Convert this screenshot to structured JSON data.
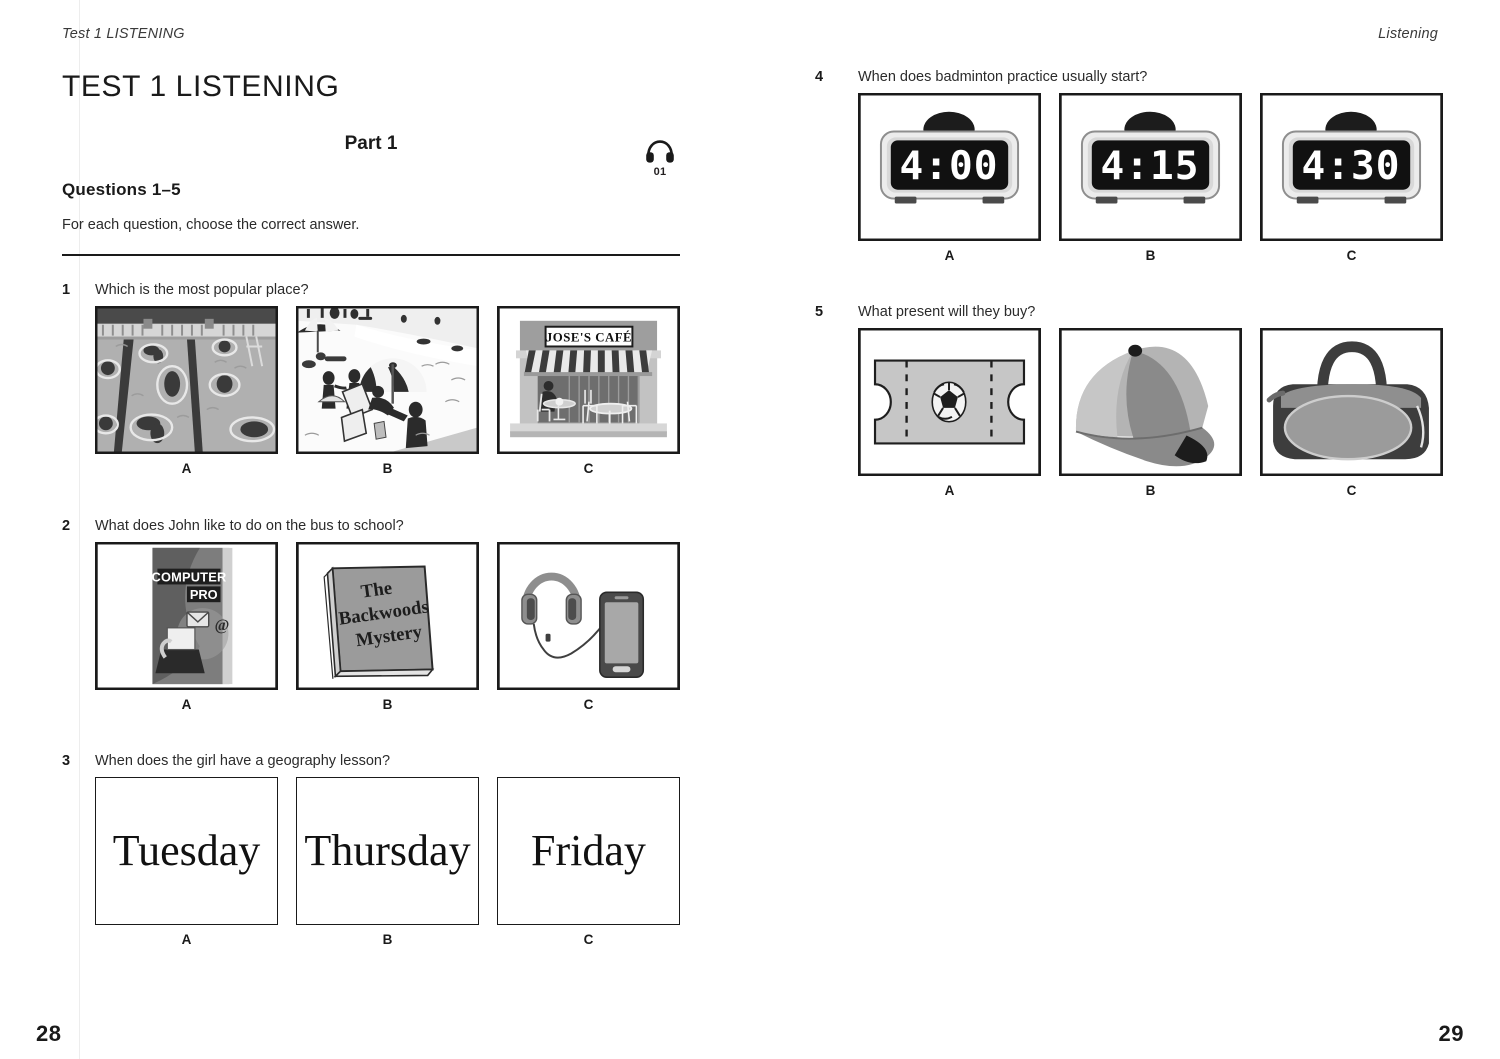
{
  "left_page": {
    "running_head": "Test 1 LISTENING",
    "page_number": "28",
    "title": "TEST 1 LISTENING",
    "part_label": "Part 1",
    "audio_track": "01",
    "questions_heading": "Questions 1–5",
    "instruction": "For each question, choose the correct answer.",
    "questions": [
      {
        "number": "1",
        "text": "Which is the most popular place?",
        "options": [
          {
            "label": "A",
            "image": "swimming-pool-with-swimmers"
          },
          {
            "label": "B",
            "image": "beach-with-parasols"
          },
          {
            "label": "C",
            "image": "cafe-storefront",
            "sign_text": "JOSE'S CAFÉ"
          }
        ]
      },
      {
        "number": "2",
        "text": "What does John like to do on the bus to school?",
        "options": [
          {
            "label": "A",
            "image": "computer-magazine",
            "cover_line1": "COMPUTER",
            "cover_line2": "PRO"
          },
          {
            "label": "B",
            "image": "hardback-book",
            "title_line1": "The",
            "title_line2": "Backwoods",
            "title_line3": "Mystery"
          },
          {
            "label": "C",
            "image": "headphones-and-smartphone"
          }
        ]
      },
      {
        "number": "3",
        "text": "When does the girl have a geography lesson?",
        "options": [
          {
            "label": "A",
            "word": "Tuesday"
          },
          {
            "label": "B",
            "word": "Thursday"
          },
          {
            "label": "C",
            "word": "Friday"
          }
        ]
      }
    ]
  },
  "right_page": {
    "running_head": "Listening",
    "page_number": "29",
    "questions": [
      {
        "number": "4",
        "text": "When does badminton practice usually start?",
        "options": [
          {
            "label": "A",
            "image": "digital-alarm-clock",
            "time": "4:00"
          },
          {
            "label": "B",
            "image": "digital-alarm-clock",
            "time": "4:15"
          },
          {
            "label": "C",
            "image": "digital-alarm-clock",
            "time": "4:30"
          }
        ]
      },
      {
        "number": "5",
        "text": "What present will they buy?",
        "options": [
          {
            "label": "A",
            "image": "football-match-ticket"
          },
          {
            "label": "B",
            "image": "baseball-cap"
          },
          {
            "label": "C",
            "image": "sports-holdall-bag"
          }
        ]
      }
    ]
  },
  "colors": {
    "ink": "#231f20",
    "rule": "#1a1a1a",
    "mid_grey": "#9a9a9a",
    "dark_grey": "#555555",
    "light_grey": "#cfcfcf"
  }
}
